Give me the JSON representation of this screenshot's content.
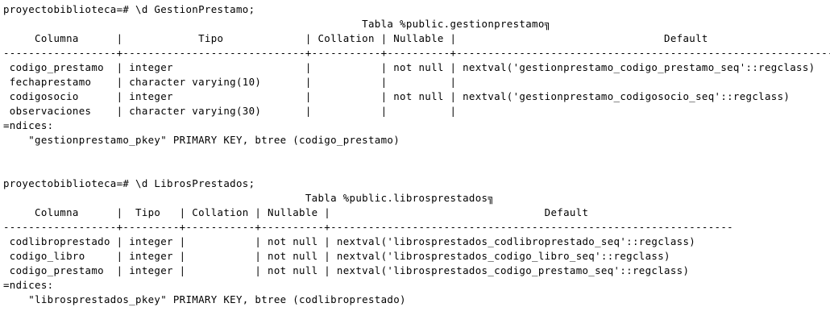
{
  "terminal": {
    "lines": [
      "proyectobiblioteca=# \\d GestionPrestamo;",
      "                                                         Tabla %public.gestionprestamo╗",
      "     Columna      |            Tipo             | Collation | Nullable |                                 Default",
      "------------------+-----------------------------+-----------+----------+-------------------------------------------------------------",
      " codigo_prestamo  | integer                     |           | not null | nextval('gestionprestamo_codigo_prestamo_seq'::regclass)",
      " fechaprestamo    | character varying(10)       |           |          |",
      " codigosocio      | integer                     |           | not null | nextval('gestionprestamo_codigosocio_seq'::regclass)",
      " observaciones    | character varying(30)       |           |          |",
      "=ndices:",
      "    \"gestionprestamo_pkey\" PRIMARY KEY, btree (codigo_prestamo)",
      "",
      "",
      "proyectobiblioteca=# \\d LibrosPrestados;",
      "                                                Tabla %public.librosprestados╗",
      "     Columna      |  Tipo   | Collation | Nullable |                                  Default",
      "------------------+---------+-----------+----------+----------------------------------------------------------------",
      " codlibroprestado | integer |           | not null | nextval('librosprestados_codlibroprestado_seq'::regclass)",
      " codigo_libro     | integer |           | not null | nextval('librosprestados_codigo_libro_seq'::regclass)",
      " codigo_prestamo  | integer |           | not null | nextval('librosprestados_codigo_prestamo_seq'::regclass)",
      "=ndices:",
      "    \"librosprestados_pkey\" PRIMARY KEY, btree (codlibroprestado)"
    ]
  }
}
